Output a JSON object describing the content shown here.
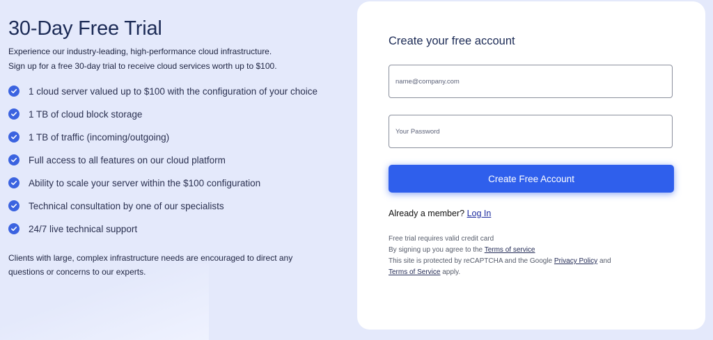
{
  "left": {
    "title": "30-Day Free Trial",
    "intro_line1": "Experience our industry-leading, high-performance cloud infrastructure.",
    "intro_line2": "Sign up for a free 30-day trial to receive cloud services worth up to $100.",
    "features": [
      "1 cloud server valued up to $100 with the configuration of your choice",
      "1 TB of cloud block storage",
      "1 TB of traffic (incoming/outgoing)",
      "Full access to all features on our cloud platform",
      "Ability to scale your server within the $100 configuration",
      "Technical consultation by one of our specialists",
      "24/7 live technical support"
    ],
    "outro": "Clients with large, complex infrastructure needs are encouraged to direct any questions or concerns to our experts."
  },
  "form": {
    "title": "Create your free account",
    "email_placeholder": "name@company.com",
    "email_value": "",
    "password_placeholder": "Your Password",
    "password_value": "",
    "submit_label": "Create Free Account",
    "member_text": "Already a member?",
    "login_label": "Log In",
    "legal_line1": "Free trial requires valid credit card",
    "legal_line2_prefix": "By signing up you agree to the",
    "terms_label": "Terms of service",
    "legal_line3_prefix": "This site is protected by reCAPTCHA and the Google",
    "privacy_label": "Privacy Policy",
    "legal_line3_and": "and",
    "tos_label": "Terms of Service",
    "legal_line4_suffix": "apply."
  },
  "icons": {
    "check": "check-circle-icon"
  },
  "colors": {
    "background": "#e4e9fb",
    "accent": "#2f5fec",
    "check": "#3b63e0",
    "card": "#ffffff"
  }
}
